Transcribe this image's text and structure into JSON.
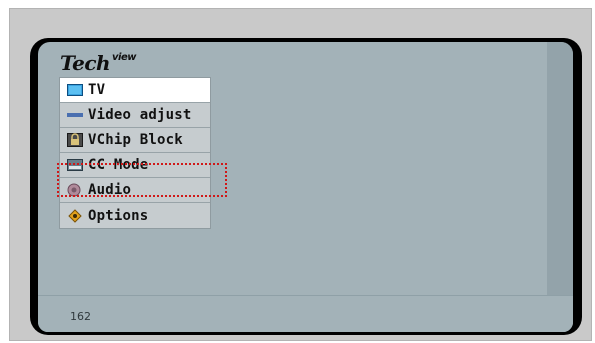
{
  "logo": {
    "main": "Tech",
    "sup": "view"
  },
  "menu": {
    "items": [
      {
        "label": "TV",
        "icon": "tv-icon",
        "selected": true
      },
      {
        "label": "Video adjust",
        "icon": "video-adjust-icon",
        "selected": false
      },
      {
        "label": "VChip Block",
        "icon": "vchip-lock-icon",
        "selected": false
      },
      {
        "label": "CC Mode",
        "icon": "closed-caption-icon",
        "selected": false
      },
      {
        "label": "Audio",
        "icon": "audio-speaker-icon",
        "selected": false
      },
      {
        "label": "Options",
        "icon": "options-gear-icon",
        "selected": false
      }
    ]
  },
  "status": {
    "channel": "162"
  },
  "colors": {
    "screen_bg": "#a3b2b8",
    "menu_bg": "#c6cccf",
    "selected_bg": "#ffffff",
    "highlight": "#d01818"
  }
}
